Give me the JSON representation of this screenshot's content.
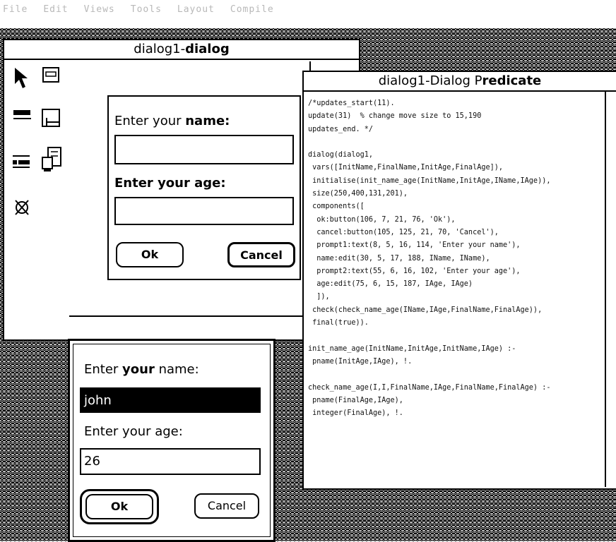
{
  "menu": [
    "File",
    "Edit",
    "Views",
    "Tools",
    "Layout",
    "Compile"
  ],
  "editor": {
    "title_plain": "dialog1-",
    "title_bold": "dialog",
    "prompt1_pre": "Enter your ",
    "prompt1_bold": "name:",
    "prompt2": "Enter your age:",
    "ok": "Ok",
    "cancel": "Cancel"
  },
  "predicate": {
    "title_plain": "dialog1-Dialog P",
    "title_bold": "redicate",
    "code": "/*updates_start(11).\nupdate(31)  % change move size to 15,190\nupdates_end. */\n\ndialog(dialog1,\n vars([InitName,FinalName,InitAge,FinalAge]),\n initialise(init_name_age(InitName,InitAge,IName,IAge)),\n size(250,400,131,201),\n components([\n  ok:button(106, 7, 21, 76, 'Ok'),\n  cancel:button(105, 125, 21, 70, 'Cancel'),\n  prompt1:text(8, 5, 16, 114, 'Enter your name'),\n  name:edit(30, 5, 17, 188, IName, IName),\n  prompt2:text(55, 6, 16, 102, 'Enter your age'),\n  age:edit(75, 6, 15, 187, IAge, IAge)\n  ]),\n check(check_name_age(IName,IAge,FinalName,FinalAge)),\n final(true)).\n\ninit_name_age(InitName,InitAge,InitName,IAge) :-\n pname(InitAge,IAge), !.\n\ncheck_name_age(I,I,FinalName,IAge,FinalName,FinalAge) :-\n pname(FinalAge,IAge),\n integer(FinalAge), !."
  },
  "runtime": {
    "prompt1_pre": "Enter ",
    "prompt1_bold": "your",
    "prompt1_post": " name:",
    "name_value": "john",
    "prompt2": "Enter your age:",
    "age_value": "26",
    "ok": "Ok",
    "cancel": "Cancel"
  }
}
